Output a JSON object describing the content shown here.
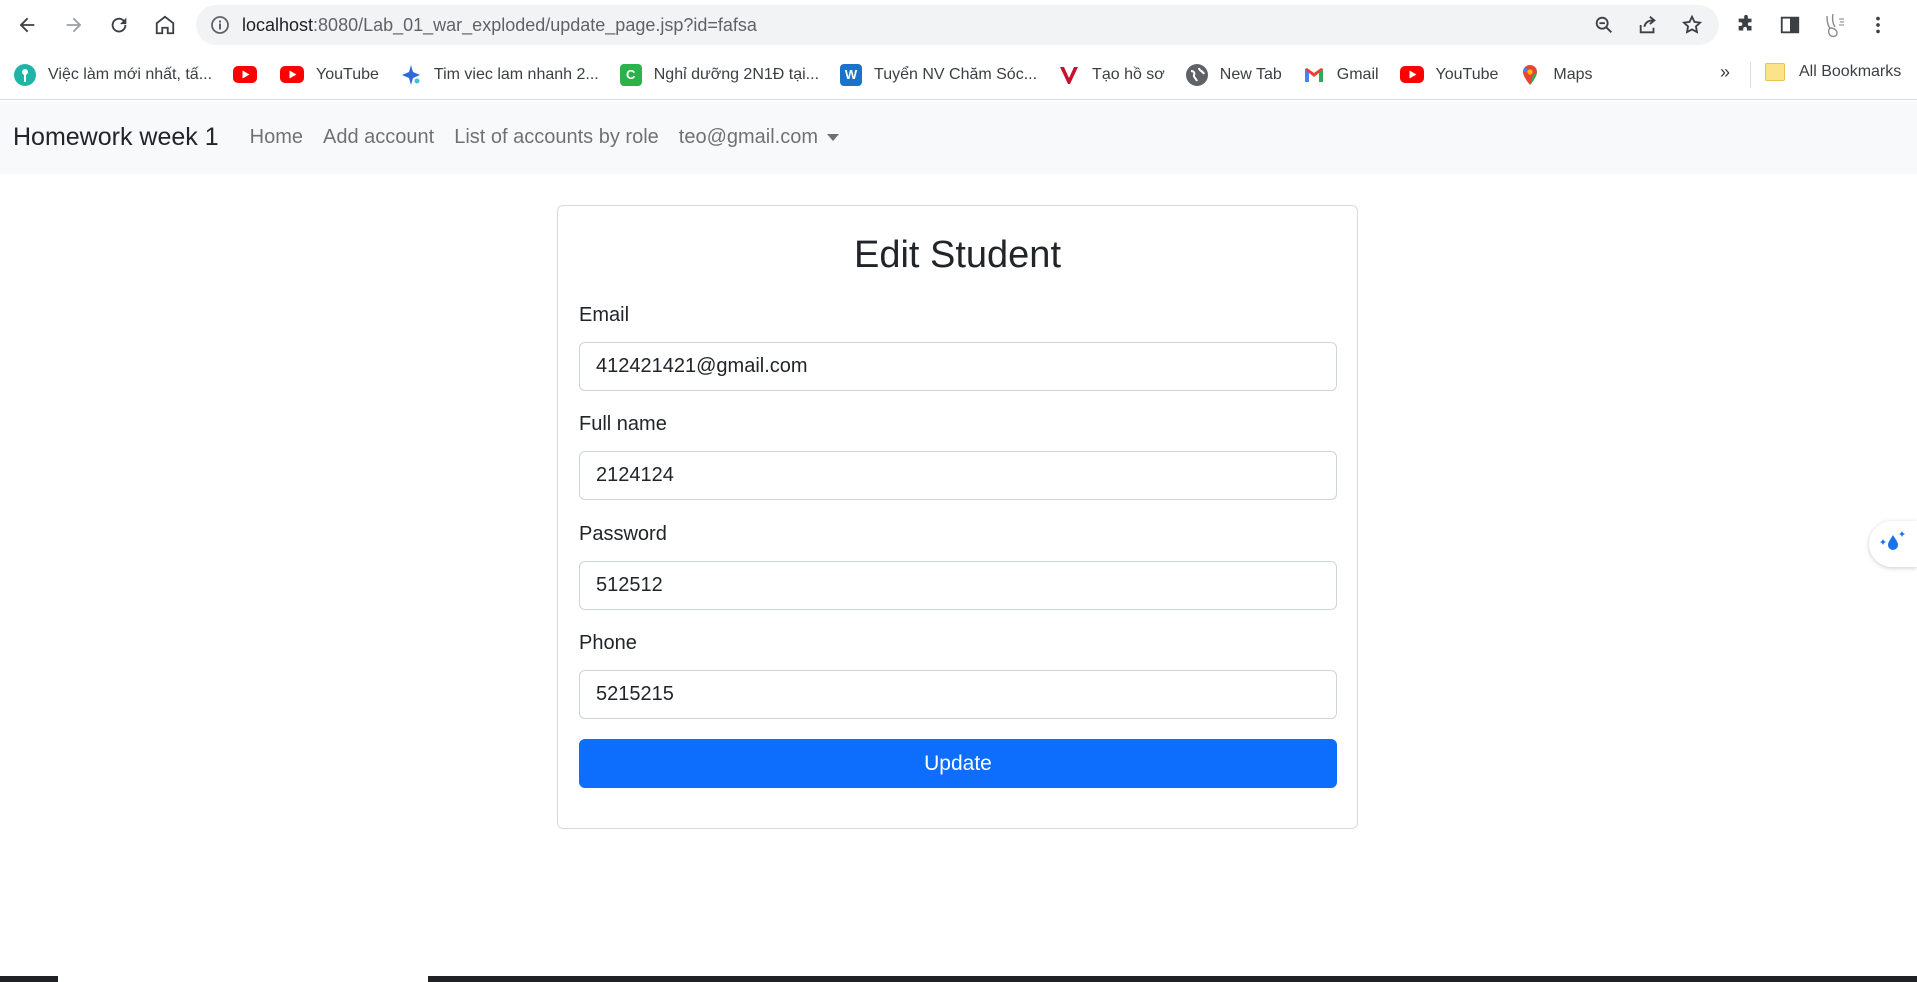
{
  "browser": {
    "url_host": "localhost",
    "url_path": ":8080/Lab_01_war_exploded/update_page.jsp?id=fafsa",
    "icons": [
      "back-icon",
      "forward-icon",
      "reload-icon",
      "home-icon",
      "info-icon",
      "zoom-icon",
      "share-icon",
      "star-icon",
      "extensions-icon",
      "sidepanel-icon",
      "profile-icon",
      "menu-icon"
    ]
  },
  "bookmarks": {
    "items": [
      {
        "label": "Việc làm mới nhất, tấ...",
        "icon": "pin-icon",
        "color": "#1fb5a6"
      },
      {
        "label": "",
        "icon": "youtube-icon",
        "color": "#ff0000"
      },
      {
        "label": "YouTube",
        "icon": "youtube-icon",
        "color": "#ff0000"
      },
      {
        "label": "Tim viec lam nhanh 2...",
        "icon": "sparkle-icon",
        "color": "#2f6bd8"
      },
      {
        "label": "Nghỉ dưỡng 2N1Đ tại...",
        "icon": "c-icon",
        "color": "#2bb24c"
      },
      {
        "label": "Tuyển NV Chăm Sóc...",
        "icon": "w-icon",
        "color": "#1a73c8"
      },
      {
        "label": "Tạo hồ sơ",
        "icon": "v-icon",
        "color": "#c8102e"
      },
      {
        "label": "New Tab",
        "icon": "globe-icon",
        "color": "#5f6368"
      },
      {
        "label": "Gmail",
        "icon": "gmail-icon",
        "color": "#ea4335"
      },
      {
        "label": "YouTube",
        "icon": "youtube-icon",
        "color": "#ff0000"
      },
      {
        "label": "Maps",
        "icon": "maps-icon",
        "color": "#34a853"
      }
    ],
    "more": "»",
    "all_bookmarks": "All Bookmarks"
  },
  "navbar": {
    "brand": "Homework week 1",
    "links": [
      "Home",
      "Add account",
      "List of accounts by role"
    ],
    "user": "teo@gmail.com"
  },
  "form": {
    "title": "Edit Student",
    "fields": [
      {
        "label": "Email",
        "value": "412421421@gmail.com"
      },
      {
        "label": "Full name",
        "value": "2124124"
      },
      {
        "label": "Password",
        "value": "512512"
      },
      {
        "label": "Phone",
        "value": "5215215"
      }
    ],
    "submit": "Update"
  },
  "colors": {
    "primary": "#0d6efd",
    "navbar_bg": "#f8f9fa"
  }
}
